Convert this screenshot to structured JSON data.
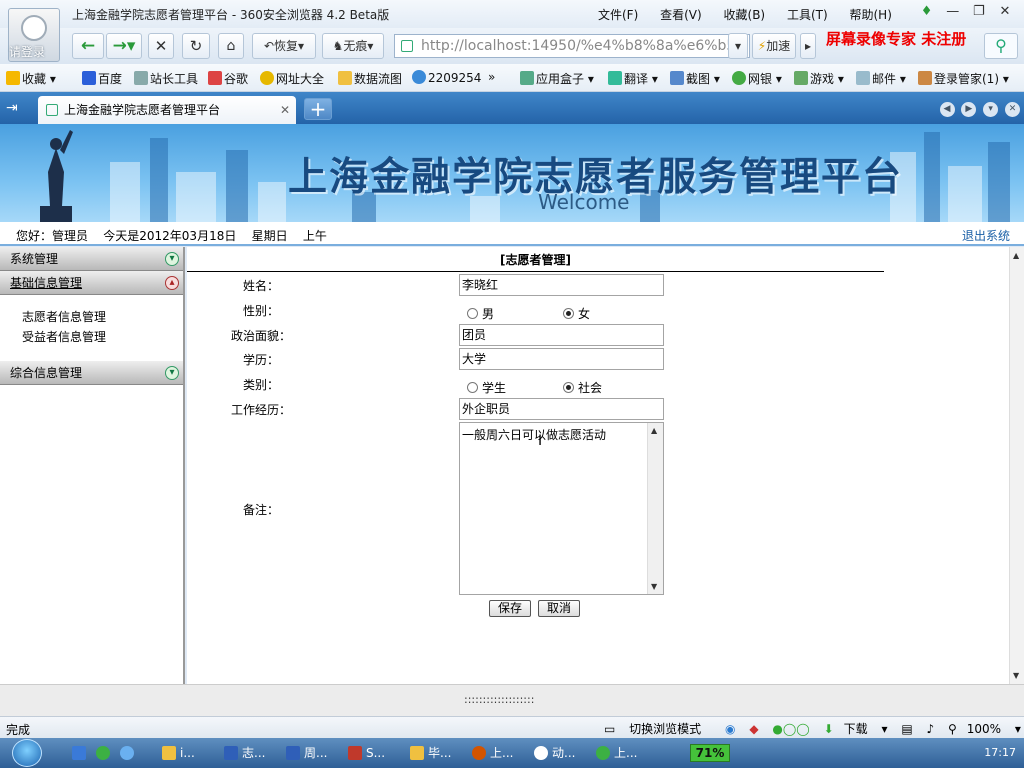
{
  "browser": {
    "window_title": "上海金融学院志愿者管理平台 - 360安全浏览器 4.2 Beta版",
    "avatar_label": "请登录",
    "menu": [
      "文件(F)",
      "查看(V)",
      "收藏(B)",
      "工具(T)",
      "帮助(H)"
    ],
    "nav": {
      "restore": "恢复",
      "incognito": "无痕",
      "accelerate": "加速"
    },
    "address": "http://localhost:14950/%e4%b8%8a%e6%b5%9",
    "watermark": "屏幕录像专家  未注册",
    "favorites": [
      "收藏",
      "百度",
      "站长工具",
      "谷歌",
      "网址大全",
      "数据流图",
      "2209254",
      "»",
      "应用盒子",
      "翻译",
      "截图",
      "网银",
      "游戏",
      "邮件",
      "登录管家(1)"
    ],
    "tab_title": "上海金融学院志愿者管理平台",
    "status": "完成",
    "status_right": [
      "切换浏览模式",
      "下载",
      "100%"
    ]
  },
  "site": {
    "banner_title": "上海金融学院志愿者服务管理平台",
    "banner_subtitle": "Welcome",
    "greeting": "您好：管理员    今天是2012年03月18日    星期日    上午",
    "logout": "退出系统"
  },
  "sidebar": {
    "sections": [
      {
        "title": "系统管理",
        "open": false,
        "items": []
      },
      {
        "title": "基础信息管理",
        "open": true,
        "items": [
          "志愿者信息管理",
          "受益者信息管理"
        ]
      },
      {
        "title": "综合信息管理",
        "open": false,
        "items": []
      }
    ]
  },
  "form": {
    "title": "[志愿者管理]",
    "name_label": "姓名：",
    "name_value": "李晓红",
    "gender_label": "性别：",
    "gender_male": "男",
    "gender_female": "女",
    "gender_selected": "女",
    "political_label": "政治面貌：",
    "political_value": "团员",
    "education_label": "学历：",
    "education_value": "大学",
    "category_label": "类别：",
    "category_student": "学生",
    "category_society": "社会",
    "category_selected": "社会",
    "work_label": "工作经历：",
    "work_value": "外企职员",
    "remark_label": "备注：",
    "remark_value": "一般周六日可以做志愿活动",
    "save": "保存",
    "cancel": "取消"
  },
  "splitter": ":::::::::::::::::::",
  "taskbar": {
    "tasks": [
      "i...",
      "志...",
      "周...",
      "S...",
      "毕...",
      "上...",
      "动...",
      "上..."
    ],
    "battery": "71%",
    "clock": "17:17"
  }
}
